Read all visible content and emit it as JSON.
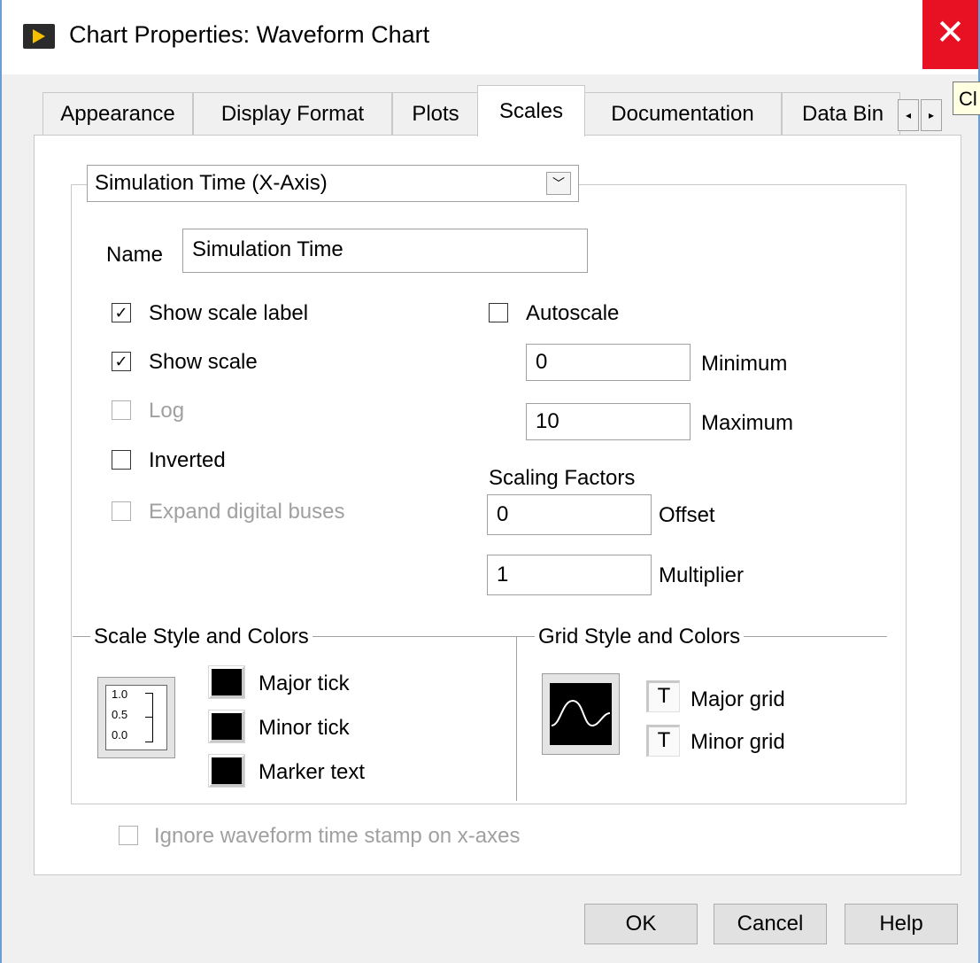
{
  "window": {
    "title": "Chart Properties: Waveform Chart",
    "close_glyph": "✕",
    "tooltip_fragment": "Cl"
  },
  "tabs": [
    {
      "label": "Appearance",
      "active": false
    },
    {
      "label": "Display Format",
      "active": false
    },
    {
      "label": "Plots",
      "active": false
    },
    {
      "label": "Scales",
      "active": true
    },
    {
      "label": "Documentation",
      "active": false
    },
    {
      "label": "Data Bin",
      "active": false
    }
  ],
  "tab_scroll": {
    "left": "◂",
    "right": "▸"
  },
  "axis_select": {
    "value": "Simulation Time (X-Axis)",
    "arrow": "﹀"
  },
  "name": {
    "label": "Name",
    "value": "Simulation Time"
  },
  "options": {
    "show_scale_label": {
      "label": "Show scale label",
      "checked": true,
      "enabled": true
    },
    "show_scale": {
      "label": "Show scale",
      "checked": true,
      "enabled": true
    },
    "log": {
      "label": "Log",
      "checked": false,
      "enabled": false
    },
    "inverted": {
      "label": "Inverted",
      "checked": false,
      "enabled": true
    },
    "expand_digital_buses": {
      "label": "Expand digital buses",
      "checked": false,
      "enabled": false
    },
    "autoscale": {
      "label": "Autoscale",
      "checked": false,
      "enabled": true
    }
  },
  "check_glyph": "✓",
  "range": {
    "minimum_label": "Minimum",
    "minimum_value": "0",
    "maximum_label": "Maximum",
    "maximum_value": "10"
  },
  "scaling": {
    "title": "Scaling Factors",
    "offset_label": "Offset",
    "offset_value": "0",
    "multiplier_label": "Multiplier",
    "multiplier_value": "1"
  },
  "scale_style": {
    "title": "Scale Style and Colors",
    "ticks": [
      "1.0",
      "0.5",
      "0.0"
    ],
    "major_tick": "Major tick",
    "minor_tick": "Minor tick",
    "marker_text": "Marker text",
    "swatch_color": "#000000"
  },
  "grid_style": {
    "title": "Grid Style and Colors",
    "glyph": "T",
    "major_grid": "Major grid",
    "minor_grid": "Minor grid"
  },
  "ignore_timestamp": {
    "label": "Ignore waveform time stamp on x-axes",
    "checked": false,
    "enabled": false
  },
  "buttons": {
    "ok": "OK",
    "cancel": "Cancel",
    "help": "Help"
  },
  "colors": {
    "close": "#e81123",
    "app_icon_bg": "#2b2b2b",
    "app_icon_fg": "#f6c000"
  }
}
